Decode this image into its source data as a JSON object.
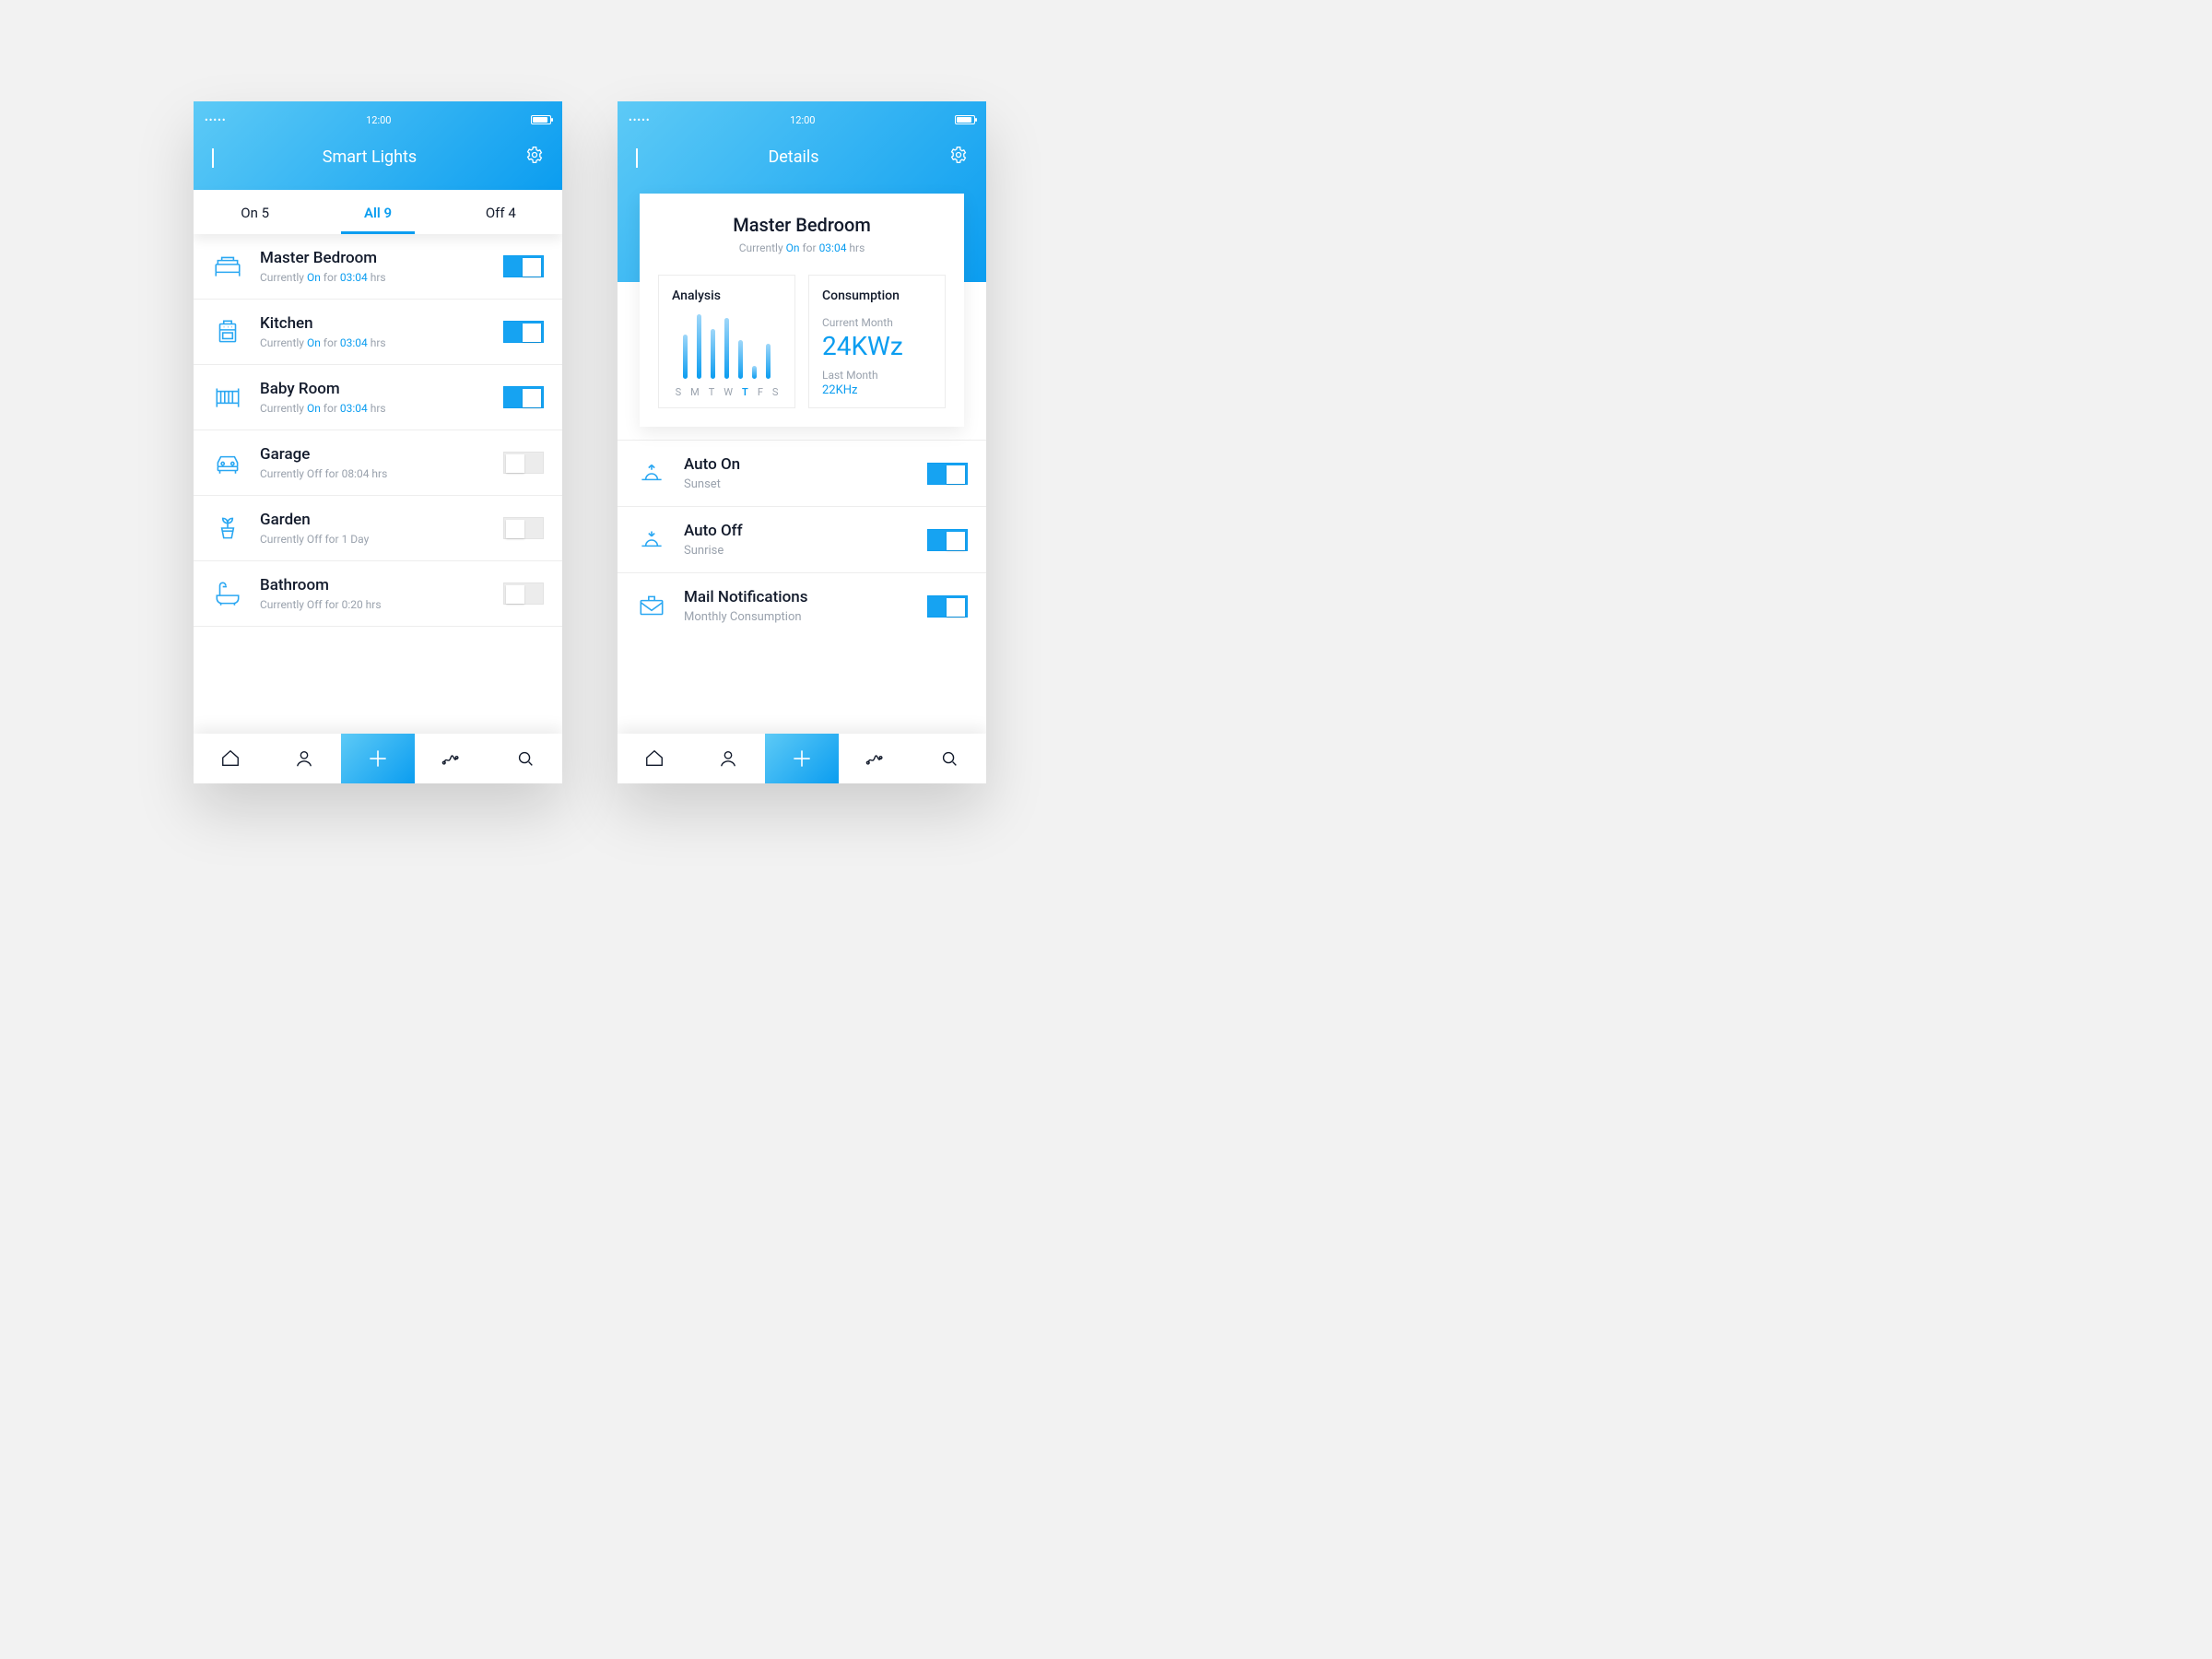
{
  "status": {
    "dots": "•••••",
    "time": "12:00"
  },
  "left": {
    "title": "Smart Lights",
    "tabs": {
      "on": "On 5",
      "all": "All 9",
      "off": "Off 4"
    },
    "rooms": [
      {
        "name": "Master Bedroom",
        "pre": "Currently ",
        "state": "On",
        "mid": " for ",
        "dur": "03:04",
        "suf": " hrs",
        "on": true,
        "icon": "bed"
      },
      {
        "name": "Kitchen",
        "pre": "Currently ",
        "state": "On",
        "mid": " for ",
        "dur": "03:04",
        "suf": " hrs",
        "on": true,
        "icon": "oven"
      },
      {
        "name": "Baby Room",
        "pre": "Currently ",
        "state": "On",
        "mid": " for ",
        "dur": "03:04",
        "suf": " hrs",
        "on": true,
        "icon": "crib"
      },
      {
        "name": "Garage",
        "pre": "Currently Off for 08:04 hrs",
        "state": "",
        "mid": "",
        "dur": "",
        "suf": "",
        "on": false,
        "icon": "car"
      },
      {
        "name": "Garden",
        "pre": "Currently Off for 1 Day",
        "state": "",
        "mid": "",
        "dur": "",
        "suf": "",
        "on": false,
        "icon": "plant"
      },
      {
        "name": "Bathroom",
        "pre": "Currently Off for 0:20 hrs",
        "state": "",
        "mid": "",
        "dur": "",
        "suf": "",
        "on": false,
        "icon": "bath"
      }
    ]
  },
  "right": {
    "title": "Details",
    "card": {
      "name": "Master Bedroom",
      "sub_pre": "Currently ",
      "sub_state": "On",
      "sub_mid": " for ",
      "sub_dur": "03:04",
      "sub_suf": " hrs"
    },
    "analysis": {
      "title": "Analysis",
      "days": [
        "S",
        "M",
        "T",
        "W",
        "T",
        "F",
        "S"
      ],
      "current_index": 4
    },
    "consumption": {
      "title": "Consumption",
      "cm_label": "Current Month",
      "cm_value": "24KWz",
      "lm_label": "Last Month",
      "lm_value": "22KHz"
    },
    "settings": [
      {
        "name": "Auto On",
        "sub": "Sunset",
        "icon": "sunset"
      },
      {
        "name": "Auto Off",
        "sub": "Sunrise",
        "icon": "sunrise"
      },
      {
        "name": "Mail Notifications",
        "sub": "Monthly Consumption",
        "icon": "mail"
      }
    ]
  },
  "chart_data": {
    "type": "bar",
    "categories": [
      "S",
      "M",
      "T",
      "W",
      "T",
      "F",
      "S"
    ],
    "values": [
      48,
      70,
      54,
      66,
      42,
      14,
      38
    ],
    "title": "Analysis",
    "xlabel": "",
    "ylabel": "",
    "ylim": [
      0,
      72
    ],
    "highlight_index": 4
  }
}
